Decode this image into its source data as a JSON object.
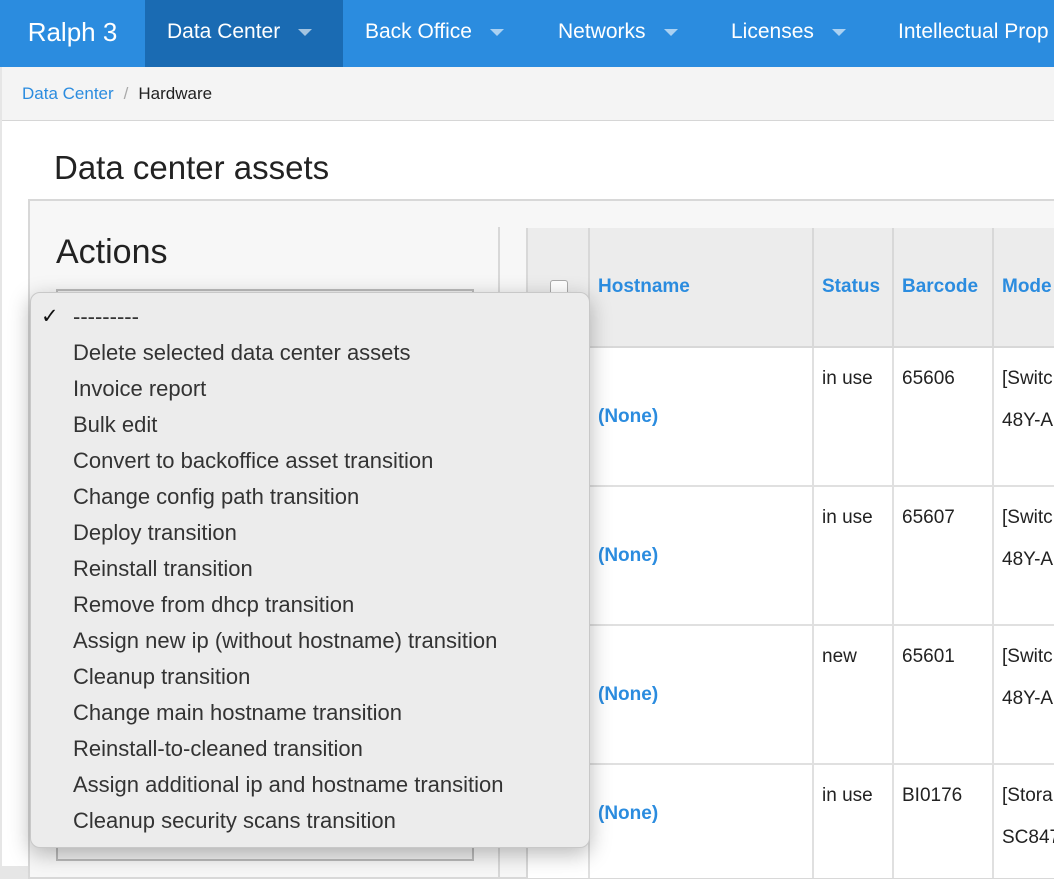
{
  "brand": "Ralph 3",
  "nav": [
    {
      "label": "Data Center",
      "active": true
    },
    {
      "label": "Back Office",
      "active": false
    },
    {
      "label": "Networks",
      "active": false
    },
    {
      "label": "Licenses",
      "active": false
    },
    {
      "label": "Intellectual Prop",
      "active": false
    }
  ],
  "breadcrumb": {
    "parent": "Data Center",
    "separator": "/",
    "current": "Hardware"
  },
  "page_title": "Data center assets",
  "actions": {
    "title": "Actions",
    "selected_index": 0,
    "options": [
      "---------",
      "Delete selected data center assets",
      "Invoice report",
      "Bulk edit",
      "Convert to backoffice asset transition",
      "Change config path transition",
      "Deploy transition",
      "Reinstall transition",
      "Remove from dhcp transition",
      "Assign new ip (without hostname) transition",
      "Cleanup transition",
      "Change main hostname transition",
      "Reinstall-to-cleaned transition",
      "Assign additional ip and hostname transition",
      "Cleanup security scans transition"
    ]
  },
  "table": {
    "columns": [
      "Hostname",
      "Status",
      "Barcode",
      "Mode"
    ],
    "rows": [
      {
        "hostname": "(None)",
        "status": "in use",
        "barcode": "65606",
        "model": "[Switc",
        "model_line2": "48Y-A"
      },
      {
        "hostname": "(None)",
        "status": "in use",
        "barcode": "65607",
        "model": "[Switc",
        "model_line2": "48Y-A"
      },
      {
        "hostname": "(None)",
        "status": "new",
        "barcode": "65601",
        "model": "[Switc",
        "model_line2": "48Y-A"
      },
      {
        "hostname": "(None)",
        "status": "in use",
        "barcode": "BI0176",
        "model": "[Stora",
        "model_line2": "SC847"
      }
    ]
  },
  "colors": {
    "accent": "#2b8cdf",
    "nav_active": "#1a6bb3"
  }
}
